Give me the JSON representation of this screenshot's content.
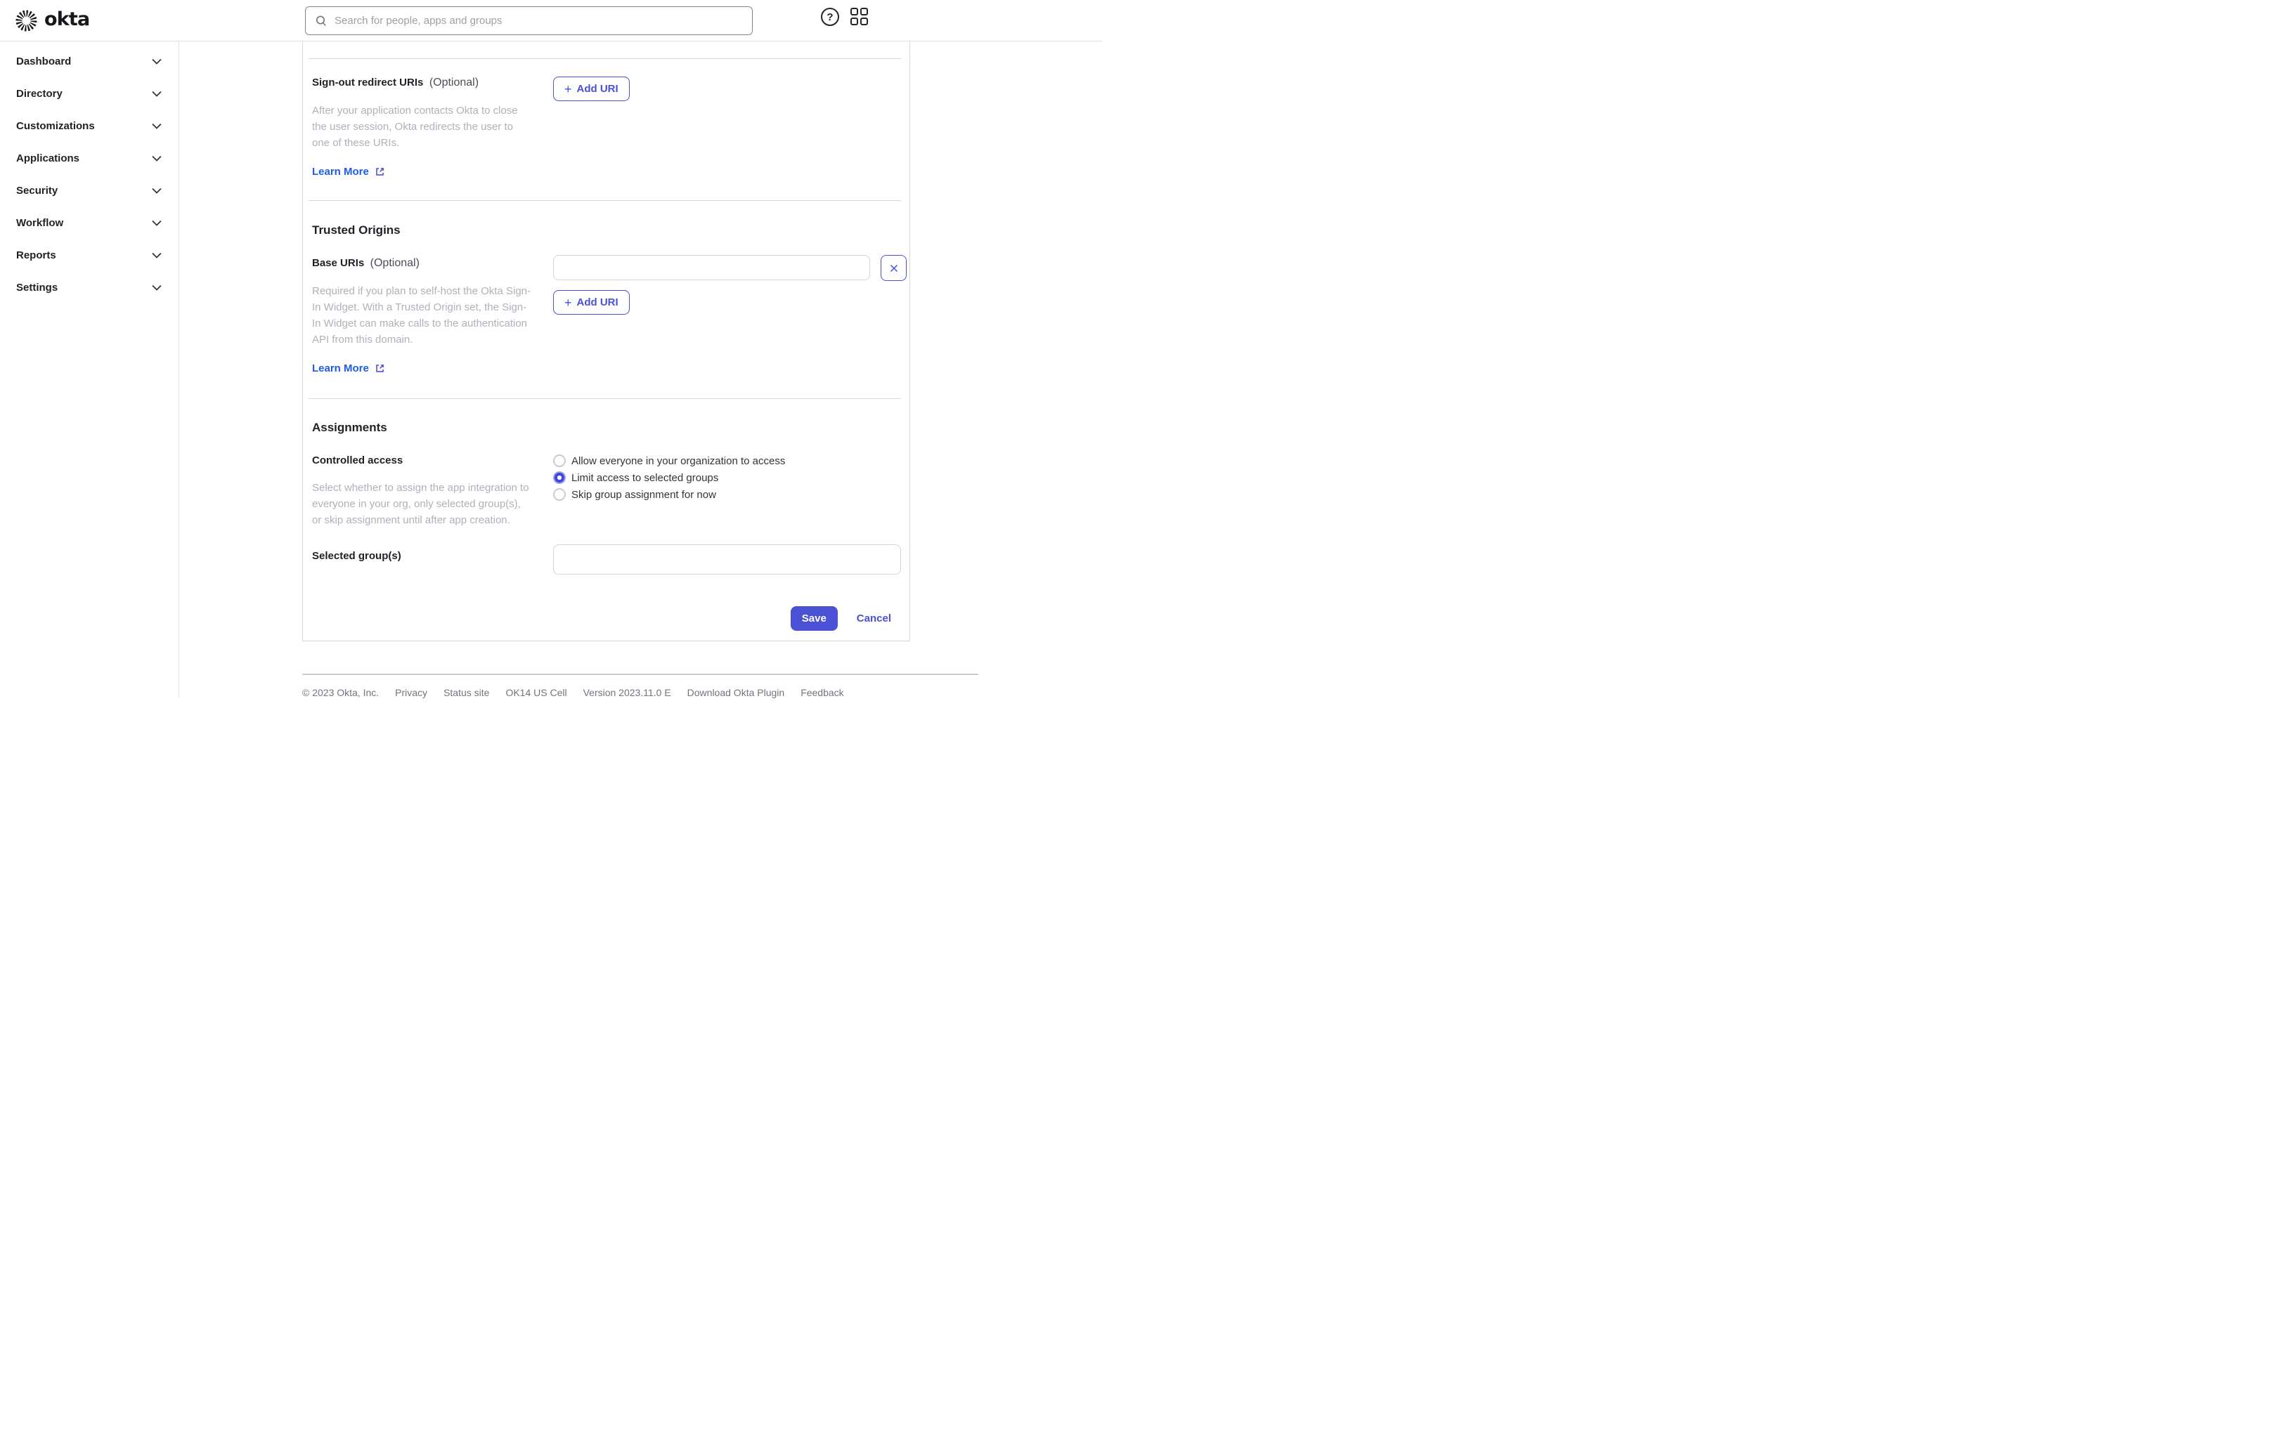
{
  "header": {
    "brand": "okta",
    "search": {
      "placeholder": "Search for people, apps and groups",
      "value": ""
    }
  },
  "sidebar": {
    "items": [
      {
        "label": "Dashboard"
      },
      {
        "label": "Directory"
      },
      {
        "label": "Customizations"
      },
      {
        "label": "Applications"
      },
      {
        "label": "Security"
      },
      {
        "label": "Workflow"
      },
      {
        "label": "Reports"
      },
      {
        "label": "Settings"
      }
    ]
  },
  "form": {
    "signout": {
      "label": "Sign-out redirect URIs",
      "optional": "(Optional)",
      "description": "After your application contacts Okta to close the user session, Okta redirects the user to one of these URIs.",
      "add_uri_label": "Add URI",
      "learn_more": "Learn More"
    },
    "trusted_origins": {
      "heading": "Trusted Origins",
      "base_uris_label": "Base URIs",
      "optional": "(Optional)",
      "base_uri_value": "",
      "description": "Required if you plan to self-host the Okta Sign-In Widget. With a Trusted Origin set, the Sign-In Widget can make calls to the authentication API from this domain.",
      "remove_label": "✕",
      "add_uri_label": "Add URI",
      "learn_more": "Learn More"
    },
    "assignments": {
      "heading": "Assignments",
      "controlled_access_label": "Controlled access",
      "description": "Select whether to assign the app integration to everyone in your org, only selected group(s), or skip assignment until after app creation.",
      "options": [
        {
          "label": "Allow everyone in your organization to access",
          "selected": false
        },
        {
          "label": "Limit access to selected groups",
          "selected": true
        },
        {
          "label": "Skip group assignment for now",
          "selected": false
        }
      ],
      "selected_groups_label": "Selected group(s)",
      "selected_groups_value": ""
    },
    "actions": {
      "save": "Save",
      "cancel": "Cancel"
    }
  },
  "footer": {
    "items": [
      "© 2023 Okta, Inc.",
      "Privacy",
      "Status site",
      "OK14 US Cell",
      "Version 2023.11.0 E",
      "Download Okta Plugin",
      "Feedback"
    ]
  },
  "colors": {
    "primary": "#4a51d4",
    "link_blue": "#1d5be8",
    "radio_halo": "#9ba1f2",
    "text_muted": "#adb2ba"
  }
}
